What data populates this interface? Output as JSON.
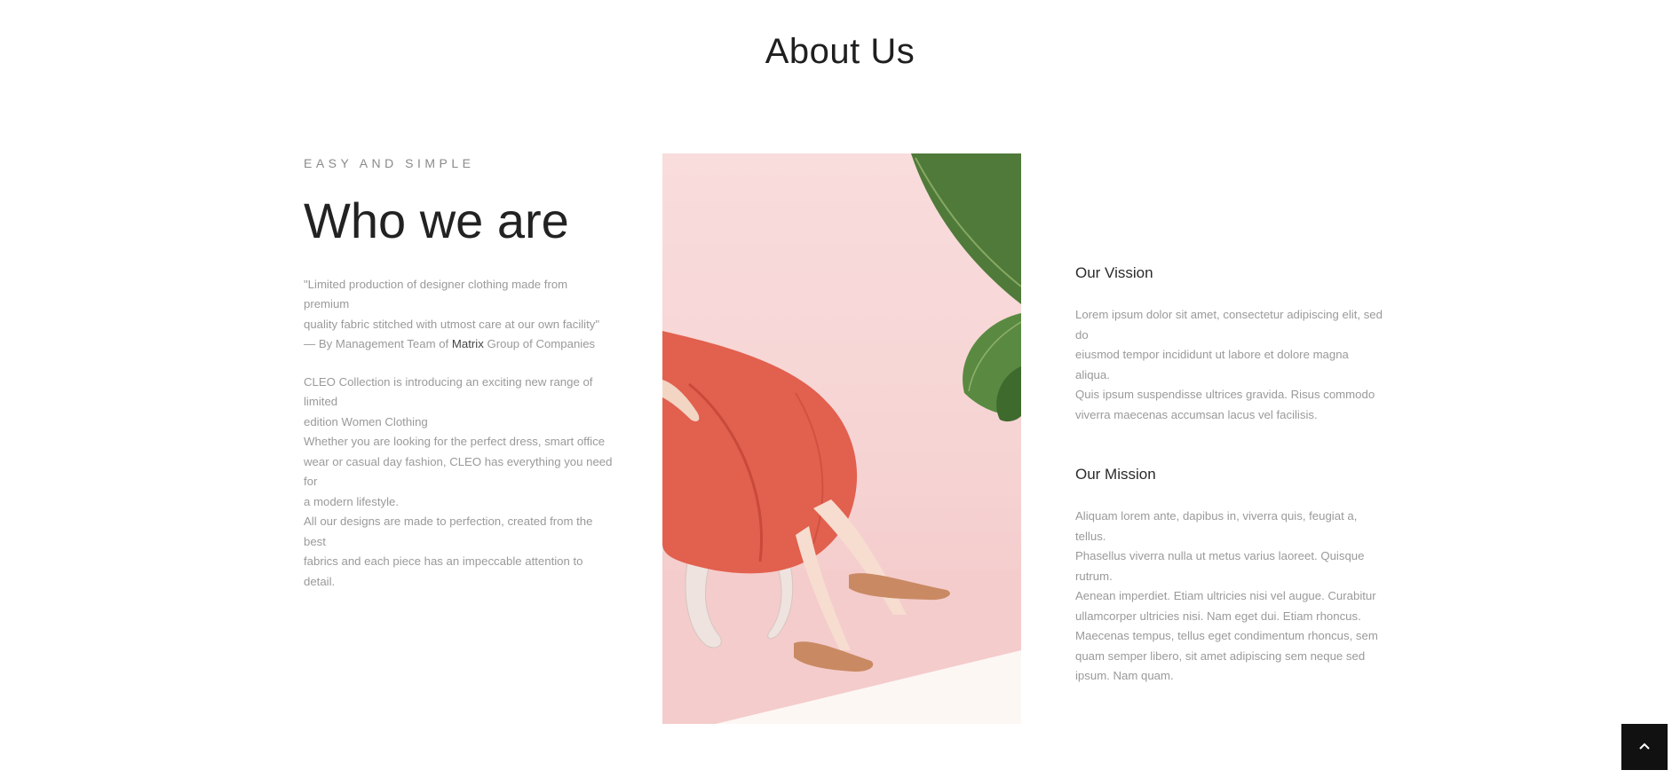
{
  "page": {
    "title": "About Us"
  },
  "who": {
    "eyebrow": "EASY AND SIMPLE",
    "heading": "Who we are",
    "quote_lines": [
      "\"Limited production of designer clothing made from premium",
      "quality fabric stitched with utmost care at our own facility\""
    ],
    "byline_prefix": "— By Management Team of ",
    "byline_brand": "Matrix",
    "byline_suffix": " Group of Companies",
    "intro_lines": [
      "CLEO Collection is introducing an exciting new range of limited",
      "edition Women Clothing",
      "Whether you are looking for the perfect dress, smart office",
      "wear or casual day fashion, CLEO has everything you need for",
      "a modern lifestyle.",
      "All our designs are made to perfection, created from the best",
      "fabrics and each piece has an impeccable attention to detail."
    ]
  },
  "vision": {
    "title": "Our Vission",
    "lines": [
      "Lorem ipsum dolor sit amet, consectetur adipiscing elit, sed do",
      "eiusmod tempor incididunt ut labore et dolore magna aliqua.",
      "Quis ipsum suspendisse ultrices gravida. Risus commodo",
      "viverra maecenas accumsan lacus vel facilisis."
    ]
  },
  "mission": {
    "title": "Our Mission",
    "lines": [
      "Aliquam lorem ante, dapibus in, viverra quis, feugiat a, tellus.",
      "Phasellus viverra nulla ut metus varius laoreet. Quisque rutrum.",
      "Aenean imperdiet. Etiam ultricies nisi vel augue. Curabitur",
      "ullamcorper ultricies nisi. Nam eget dui. Etiam rhoncus.",
      "Maecenas tempus, tellus eget condimentum rhoncus, sem",
      "quam semper libero, sit amet adipiscing sem neque sed",
      "ipsum. Nam quam."
    ]
  },
  "back_to_top": {
    "icon": "chevron-up-icon"
  },
  "colors": {
    "photo_background": "#f6d3d3",
    "dress": "#e2604e",
    "leaf": "#4f7a3a",
    "back_to_top_bg": "#111111"
  }
}
